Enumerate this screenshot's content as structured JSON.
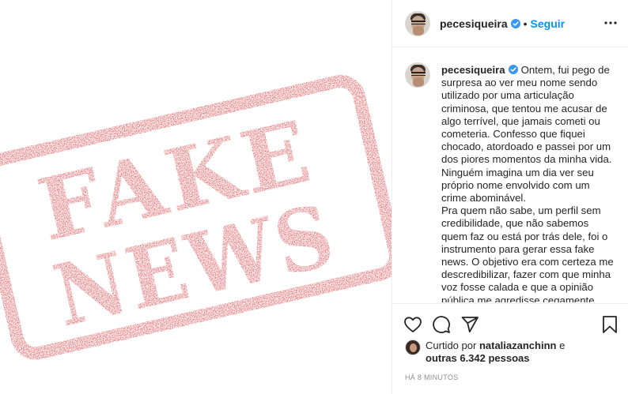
{
  "image": {
    "stamp_line1": "FAKE",
    "stamp_line2": "NEWS",
    "stamp_color": "#d0272c"
  },
  "header": {
    "username": "pecesiqueira",
    "dot": "•",
    "follow_label": "Seguir",
    "more_icon": "more-horizontal-icon"
  },
  "caption": {
    "username": "pecesiqueira",
    "paragraph1": "Ontem, fui pego de surpresa ao ver meu nome sendo utilizado por uma articulação criminosa, que tentou me acusar de algo terrível, que jamais cometi ou cometeria. Confesso que fiquei chocado, atordoado e passei por um dos piores momentos da minha vida. Ninguém imagina um dia ver seu próprio nome envolvido com um crime abominável.",
    "paragraph2": "Pra quem não sabe, um perfil sem credibilidade, que não sabemos quem faz ou está por trás dele, foi o instrumento para gerar essa fake news. O objetivo era com certeza me descredibilizar, fazer com que minha voz fosse calada e que a opinião pública me agredisse cegamente. Mas"
  },
  "actions": {
    "icons": [
      "heart-icon",
      "comment-icon",
      "share-icon",
      "bookmark-icon"
    ]
  },
  "likes": {
    "prefix": "Curtido por",
    "user": "nataliazanchinn",
    "suffix": "e",
    "others": "outras 6.342 pessoas"
  },
  "timestamp": "HÁ 8 MINUTOS",
  "colors": {
    "accent": "#0095f6",
    "verified": "#3897f0",
    "muted": "#8e8e8e"
  }
}
